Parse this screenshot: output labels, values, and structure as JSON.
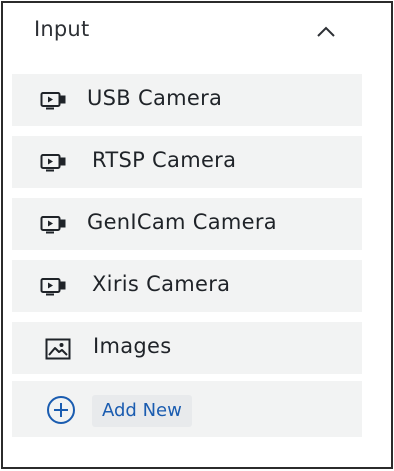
{
  "section": {
    "title": "Input",
    "collapse_icon": "chevron-up-icon"
  },
  "items": [
    {
      "label": "USB Camera",
      "icon": "video-camera-icon"
    },
    {
      "label": "RTSP Camera",
      "icon": "video-camera-icon"
    },
    {
      "label": "GenICam Camera",
      "icon": "video-camera-icon"
    },
    {
      "label": "Xiris Camera",
      "icon": "video-camera-icon"
    },
    {
      "label": "Images",
      "icon": "image-icon"
    }
  ],
  "add": {
    "label": "Add New",
    "icon": "add-circle-icon"
  },
  "colors": {
    "item_background": "#f2f3f3",
    "border": "#2b2b2b",
    "link_blue": "#1a5cb0",
    "text": "#1f2328"
  }
}
